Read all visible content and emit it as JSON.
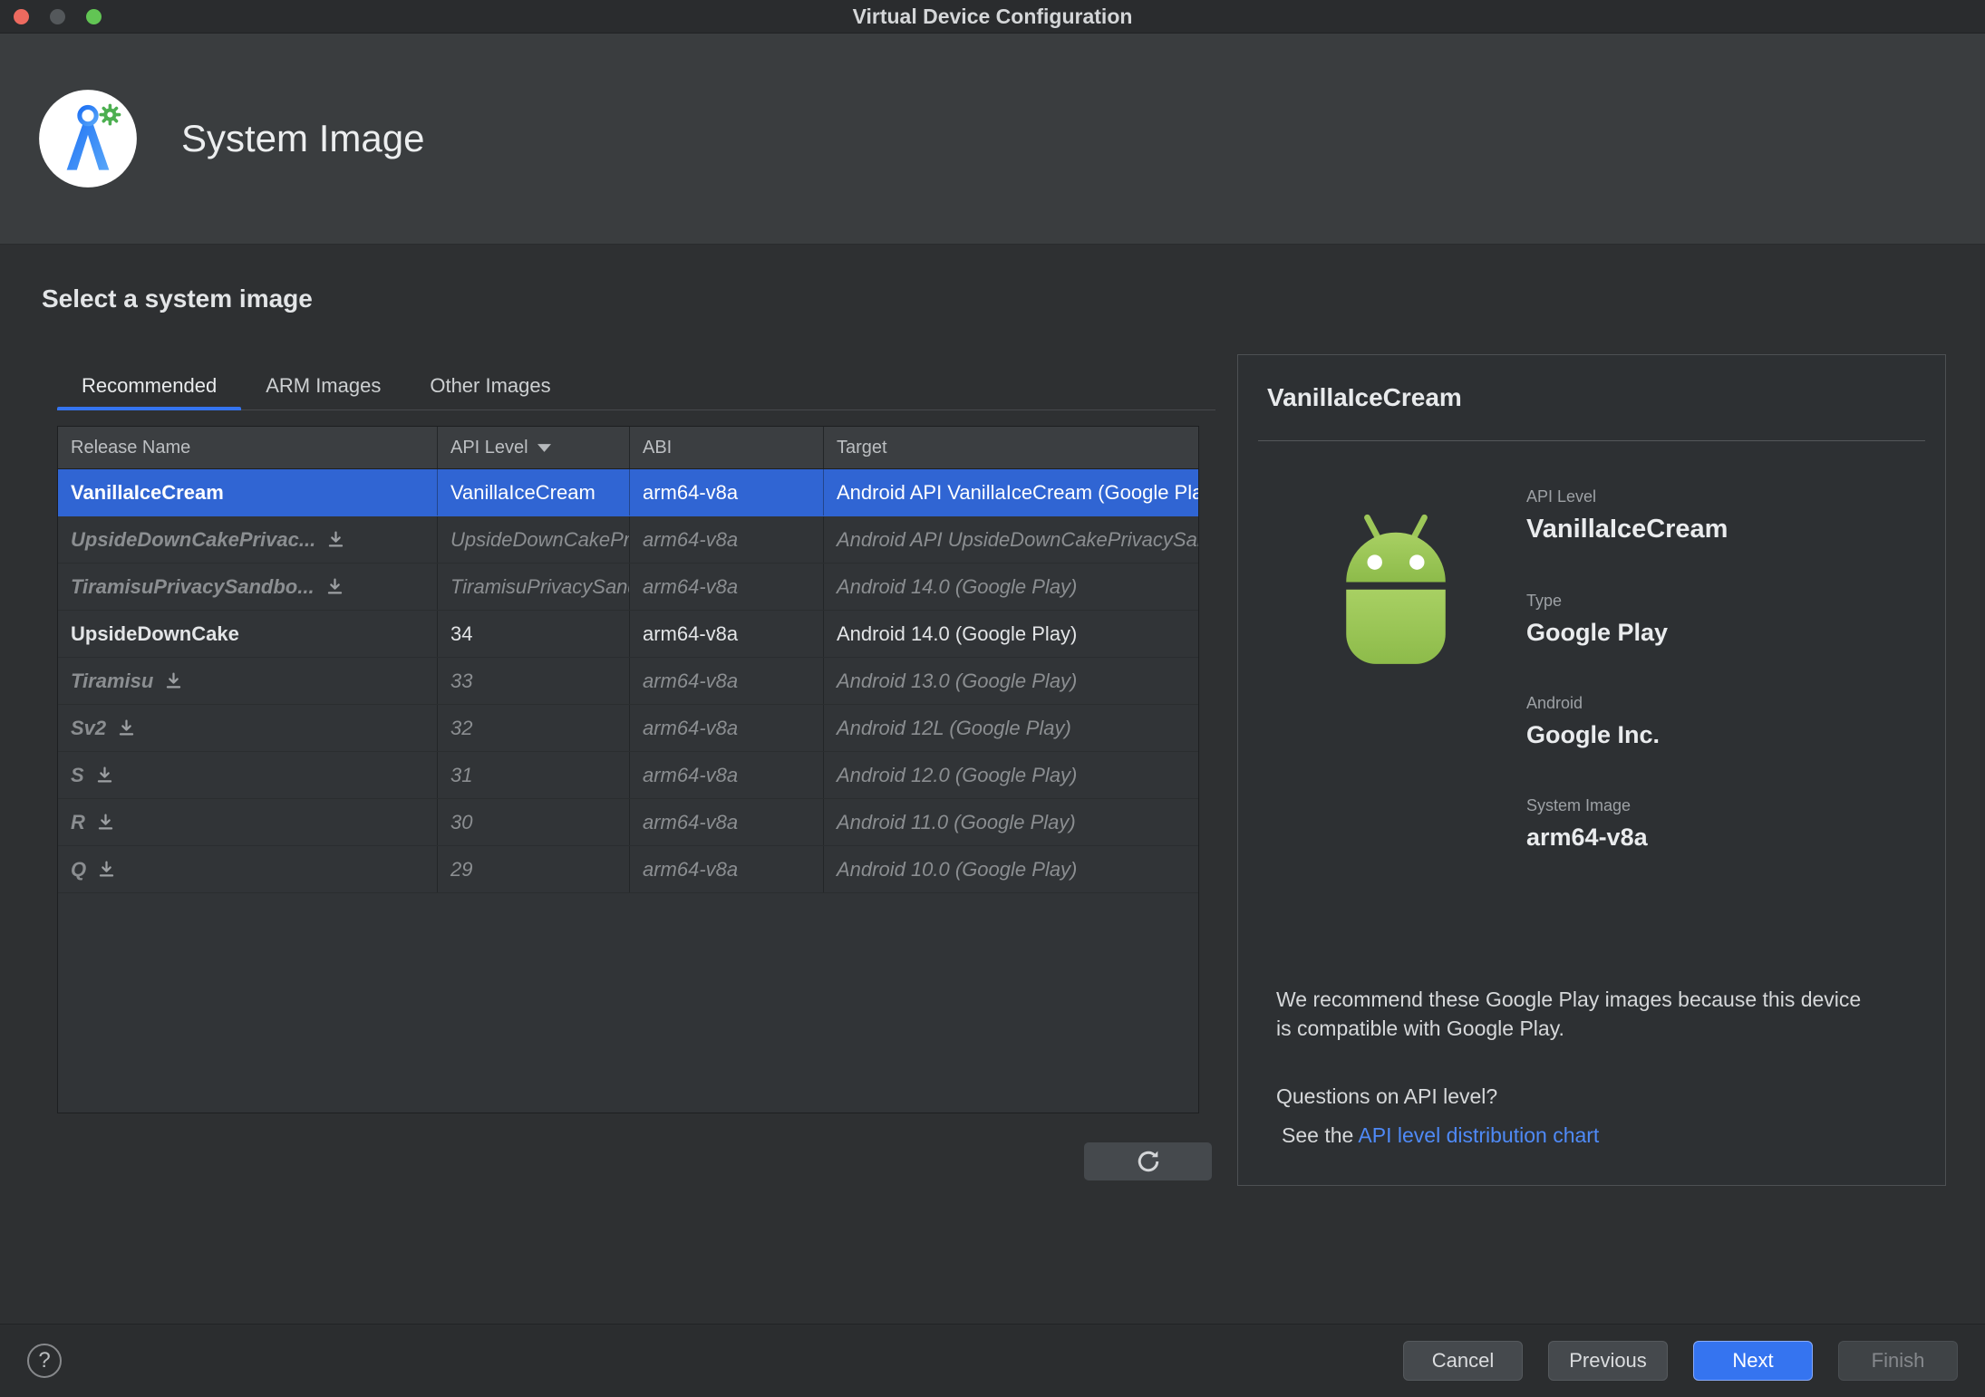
{
  "window": {
    "title": "Virtual Device Configuration"
  },
  "header": {
    "title": "System Image"
  },
  "main": {
    "heading": "Select a system image",
    "tabs": [
      {
        "label": "Recommended",
        "active": true
      },
      {
        "label": "ARM Images",
        "active": false
      },
      {
        "label": "Other Images",
        "active": false
      }
    ],
    "table": {
      "columns": [
        "Release Name",
        "API Level",
        "ABI",
        "Target"
      ],
      "sort_column": "API Level",
      "rows": [
        {
          "release": "VanillaIceCream",
          "api": "VanillaIceCream",
          "abi": "arm64-v8a",
          "target": "Android API VanillaIceCream (Google Play)",
          "state": "selected",
          "download": false
        },
        {
          "release": "UpsideDownCakePrivac...",
          "api": "UpsideDownCakePrivacySandbox",
          "abi": "arm64-v8a",
          "target": "Android API UpsideDownCakePrivacySandbox",
          "state": "dim",
          "download": true
        },
        {
          "release": "TiramisuPrivacySandbo...",
          "api": "TiramisuPrivacySandbox",
          "abi": "arm64-v8a",
          "target": "Android 14.0 (Google Play)",
          "state": "dim",
          "download": true
        },
        {
          "release": "UpsideDownCake",
          "api": "34",
          "abi": "arm64-v8a",
          "target": "Android 14.0 (Google Play)",
          "state": "installed",
          "download": false
        },
        {
          "release": "Tiramisu",
          "api": "33",
          "abi": "arm64-v8a",
          "target": "Android 13.0 (Google Play)",
          "state": "dim",
          "download": true
        },
        {
          "release": "Sv2",
          "api": "32",
          "abi": "arm64-v8a",
          "target": "Android 12L (Google Play)",
          "state": "dim",
          "download": true
        },
        {
          "release": "S",
          "api": "31",
          "abi": "arm64-v8a",
          "target": "Android 12.0 (Google Play)",
          "state": "dim",
          "download": true
        },
        {
          "release": "R",
          "api": "30",
          "abi": "arm64-v8a",
          "target": "Android 11.0 (Google Play)",
          "state": "dim",
          "download": true
        },
        {
          "release": "Q",
          "api": "29",
          "abi": "arm64-v8a",
          "target": "Android 10.0 (Google Play)",
          "state": "dim",
          "download": true
        }
      ]
    }
  },
  "details": {
    "title": "VanillaIceCream",
    "fields": [
      {
        "label": "API Level",
        "value": "VanillaIceCream"
      },
      {
        "label": "Type",
        "value": "Google Play"
      },
      {
        "label": "Android",
        "value": "Google Inc."
      },
      {
        "label": "System Image",
        "value": "arm64-v8a"
      }
    ],
    "recommendation": "We recommend these Google Play images because this device is compatible with Google Play.",
    "question": "Questions on API level?",
    "see_the": "See the ",
    "link": "API level distribution chart"
  },
  "footer": {
    "help": "?",
    "buttons": [
      {
        "label": "Cancel",
        "type": "default"
      },
      {
        "label": "Previous",
        "type": "default"
      },
      {
        "label": "Next",
        "type": "primary"
      },
      {
        "label": "Finish",
        "type": "disabled"
      }
    ]
  },
  "colors": {
    "accent": "#3574f0",
    "selection": "#3065d3",
    "link": "#4f8af7",
    "robot_green": "#9dc758"
  }
}
